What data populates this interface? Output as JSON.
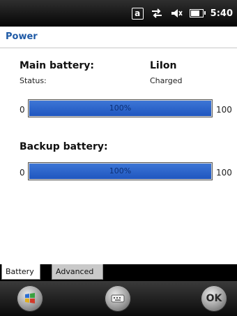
{
  "status_bar": {
    "a_icon_label": "a",
    "icons": [
      "a-box-icon",
      "sync-arrows-icon",
      "speaker-icon",
      "battery-icon"
    ],
    "time": "5:40"
  },
  "title": "Power",
  "main_battery": {
    "label": "Main battery:",
    "type": "LiIon",
    "status_label": "Status:",
    "status_value": "Charged",
    "range_min": "0",
    "range_max": "100",
    "level_percent": 100,
    "bar_text": "100%"
  },
  "backup_battery": {
    "label": "Backup battery:",
    "range_min": "0",
    "range_max": "100",
    "level_percent": 100,
    "bar_text": "100%"
  },
  "tabs": [
    {
      "label": "Battery",
      "active": true
    },
    {
      "label": "Advanced",
      "active": false
    }
  ],
  "softkeys": {
    "ok_label": "OK",
    "icons": [
      "windows-start-icon",
      "keyboard-icon",
      "ok-icon"
    ]
  },
  "colors": {
    "title": "#1f5aa6",
    "bar_fill": "#2a63c8",
    "bar_text": "#0c2f74"
  }
}
